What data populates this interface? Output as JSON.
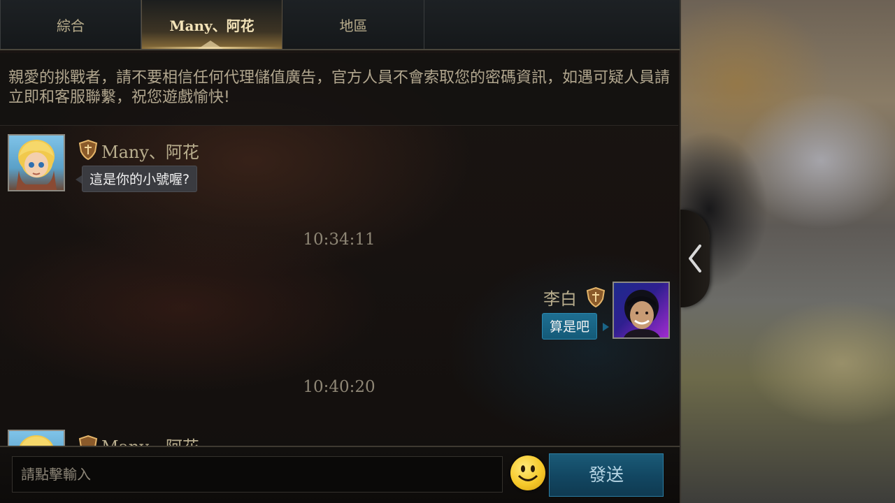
{
  "tabs": [
    {
      "label": "綜合",
      "active": false
    },
    {
      "label": "Many、阿花",
      "active": true
    },
    {
      "label": "地區",
      "active": false
    }
  ],
  "notice": {
    "text": "親愛的挑戰者，請不要相信任何代理儲值廣告，官方人員不會索取您的密碼資訊，如遇可疑人員請立即和客服聯繫，祝您遊戲愉快!"
  },
  "messages": [
    {
      "side": "left",
      "sender": "Many、阿花",
      "text": "這是你的小號喔?",
      "avatar_icon": "hero-avatar-blonde"
    },
    {
      "type": "timestamp",
      "text": "10:34:11"
    },
    {
      "side": "right",
      "sender": "李白",
      "text": "算是吧",
      "avatar_icon": "player-avatar-photo"
    },
    {
      "type": "timestamp",
      "text": "10:40:20"
    },
    {
      "side": "left",
      "sender": "Many、阿花",
      "text": "",
      "avatar_icon": "hero-avatar-blonde"
    }
  ],
  "input": {
    "placeholder": "請點擊輸入",
    "send_label": "發送",
    "emoji_icon": "smiley-emoji-icon"
  },
  "colors": {
    "accent_gold": "#f3e3b8",
    "send_blue": "#124661",
    "bubble_blue": "#1e6f92",
    "bubble_dark": "#3a3b40"
  }
}
